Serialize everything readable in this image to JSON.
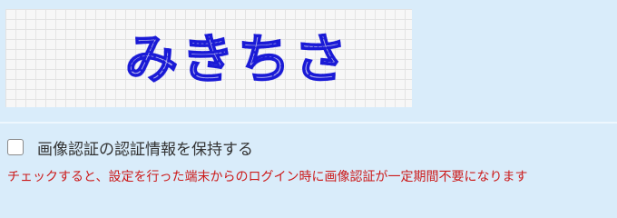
{
  "captcha": {
    "text": "みきちさ"
  },
  "remember": {
    "label": "画像認証の認証情報を保持する",
    "checked": false
  },
  "note": {
    "text": "チェックすると、設定を行った端末からのログイン時に画像認証が一定期間不要になります"
  },
  "colors": {
    "background": "#d9ecfa",
    "note_text": "#cc1a1a",
    "captcha_text": "#1a1ad6"
  }
}
